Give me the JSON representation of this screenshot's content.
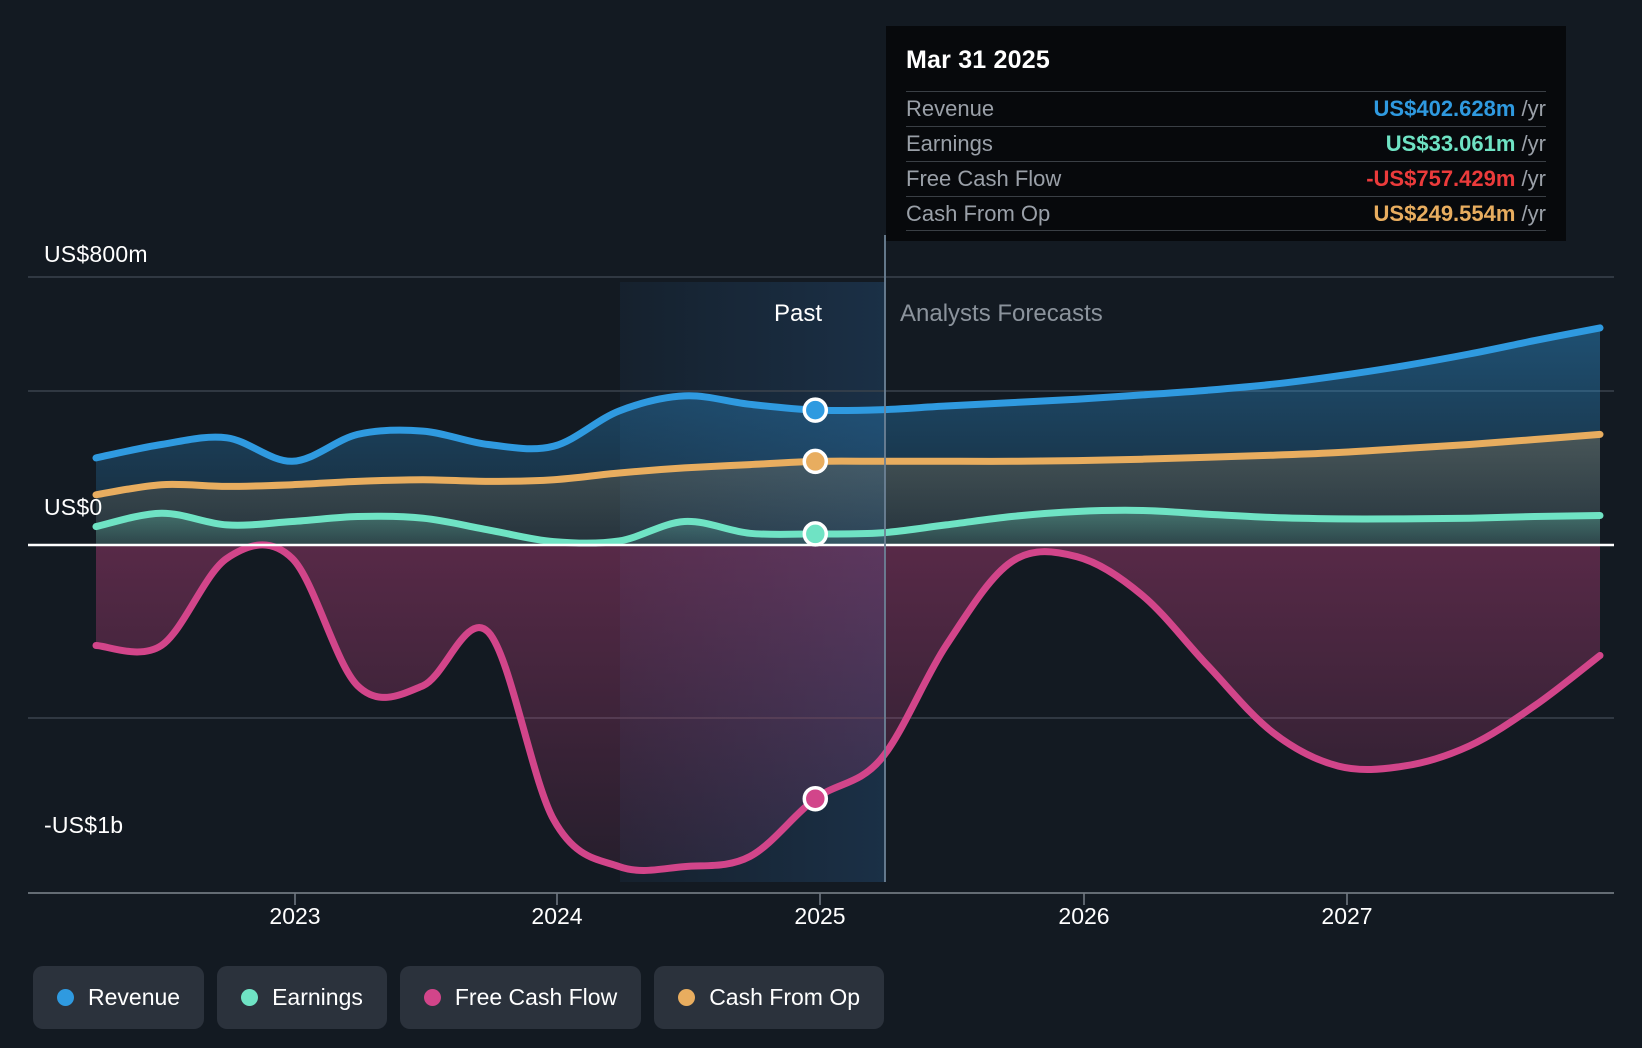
{
  "tooltip": {
    "date": "Mar 31 2025",
    "rows": [
      {
        "label": "Revenue",
        "amount": "US$402.628m",
        "unit": "/yr",
        "color": "#2f9ae0"
      },
      {
        "label": "Earnings",
        "amount": "US$33.061m",
        "unit": "/yr",
        "color": "#6fe3c4"
      },
      {
        "label": "Free Cash Flow",
        "amount": "-US$757.429m",
        "unit": "/yr",
        "color": "#eb3b3b"
      },
      {
        "label": "Cash From Op",
        "amount": "US$249.554m",
        "unit": "/yr",
        "color": "#e8ad5f"
      }
    ]
  },
  "axis": {
    "y_top": "US$800m",
    "y_zero": "US$0",
    "y_bottom": "-US$1b",
    "years": [
      "2023",
      "2024",
      "2025",
      "2026",
      "2027"
    ]
  },
  "regions": {
    "past_label": "Past",
    "forecast_label": "Analysts Forecasts"
  },
  "legend": [
    {
      "label": "Revenue",
      "color": "#2f9ae0"
    },
    {
      "label": "Earnings",
      "color": "#6fe3c4"
    },
    {
      "label": "Free Cash Flow",
      "color": "#d2458a"
    },
    {
      "label": "Cash From Op",
      "color": "#e8ad5f"
    }
  ],
  "chart_data": {
    "type": "line",
    "title": "",
    "xlabel": "",
    "ylabel": "",
    "ylim": [
      -1000,
      800
    ],
    "y_ticks": [
      800,
      400,
      0,
      -500,
      -1000
    ],
    "y_tick_labels": [
      "US$800m",
      "",
      "US$0",
      "",
      "-US$1b"
    ],
    "grid": true,
    "legend_position": "bottom-left",
    "x_range": [
      "2022-06",
      "2028-03"
    ],
    "x_ticks": [
      "2023",
      "2024",
      "2025",
      "2026",
      "2027"
    ],
    "forecast_start": "2025-06",
    "units": "US$ millions per year",
    "series": [
      {
        "name": "Revenue",
        "color": "#2f9ae0",
        "x": [
          "2022-06",
          "2022-09",
          "2022-12",
          "2023-03",
          "2023-06",
          "2023-09",
          "2023-12",
          "2024-03",
          "2024-06",
          "2024-09",
          "2024-12",
          "2025-03",
          "2025-06",
          "2025-09",
          "2025-12",
          "2026-03",
          "2026-06",
          "2026-09",
          "2026-12",
          "2027-03",
          "2027-06",
          "2027-09",
          "2027-12",
          "2028-03"
        ],
        "values": [
          260,
          300,
          320,
          250,
          330,
          340,
          300,
          295,
          400,
          445,
          420,
          402.628,
          404,
          415,
          425,
          435,
          448,
          462,
          480,
          505,
          535,
          570,
          610,
          648
        ]
      },
      {
        "name": "Earnings",
        "color": "#6fe3c4",
        "x": [
          "2022-06",
          "2022-09",
          "2022-12",
          "2023-03",
          "2023-06",
          "2023-09",
          "2023-12",
          "2024-03",
          "2024-06",
          "2024-09",
          "2024-12",
          "2025-03",
          "2025-06",
          "2025-09",
          "2025-12",
          "2026-03",
          "2026-06",
          "2026-09",
          "2026-12",
          "2027-03",
          "2027-06",
          "2027-09",
          "2027-12",
          "2028-03"
        ],
        "values": [
          55,
          95,
          60,
          70,
          85,
          80,
          45,
          10,
          12,
          70,
          35,
          33.061,
          36,
          60,
          85,
          100,
          103,
          92,
          82,
          78,
          78,
          80,
          85,
          88
        ]
      },
      {
        "name": "Free Cash Flow",
        "color": "#d2458a",
        "x": [
          "2022-06",
          "2022-09",
          "2022-12",
          "2023-03",
          "2023-06",
          "2023-09",
          "2023-12",
          "2024-03",
          "2024-06",
          "2024-09",
          "2024-12",
          "2025-03",
          "2025-06",
          "2025-09",
          "2025-12",
          "2026-03",
          "2026-06",
          "2026-09",
          "2026-12",
          "2027-03",
          "2027-06",
          "2027-09",
          "2027-12",
          "2028-03"
        ],
        "values": [
          -300,
          -300,
          -40,
          -40,
          -420,
          -420,
          -260,
          -820,
          -960,
          -960,
          -930,
          -757.429,
          -640,
          -300,
          -50,
          -35,
          -150,
          -360,
          -560,
          -660,
          -660,
          -600,
          -480,
          -330
        ]
      },
      {
        "name": "Cash From Op",
        "color": "#e8ad5f",
        "x": [
          "2022-06",
          "2022-09",
          "2022-12",
          "2023-03",
          "2023-06",
          "2023-09",
          "2023-12",
          "2024-03",
          "2024-06",
          "2024-09",
          "2024-12",
          "2025-03",
          "2025-06",
          "2025-09",
          "2025-12",
          "2026-03",
          "2026-06",
          "2026-09",
          "2026-12",
          "2027-03",
          "2027-06",
          "2027-09",
          "2027-12",
          "2028-03"
        ],
        "values": [
          150,
          180,
          175,
          180,
          190,
          195,
          190,
          195,
          215,
          230,
          240,
          249.554,
          250,
          250,
          250,
          252,
          256,
          262,
          268,
          276,
          288,
          300,
          315,
          330
        ]
      }
    ],
    "highlighted_point": {
      "date": "Mar 31 2025",
      "Revenue": 402.628,
      "Earnings": 33.061,
      "Free Cash Flow": -757.429,
      "Cash From Op": 249.554
    }
  }
}
